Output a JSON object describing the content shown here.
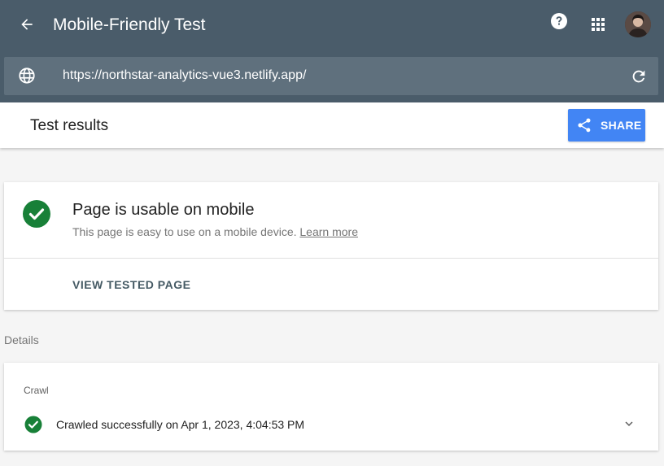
{
  "header": {
    "title": "Mobile-Friendly Test",
    "icons": {
      "back": "arrow-back-icon",
      "help": "help-icon",
      "apps": "apps-grid-icon",
      "avatar": "user-avatar"
    }
  },
  "url_bar": {
    "url": "https://northstar-analytics-vue3.netlify.app/",
    "icons": {
      "globe": "globe-icon",
      "reload": "reload-icon"
    }
  },
  "results": {
    "title": "Test results",
    "share_label": "SHARE"
  },
  "usable_card": {
    "title": "Page is usable on mobile",
    "description": "This page is easy to use on a mobile device.",
    "learn_more": "Learn more",
    "view_button": "VIEW TESTED PAGE"
  },
  "details": {
    "label": "Details",
    "crawl": {
      "label": "Crawl",
      "status": "Crawled successfully on Apr 1, 2023, 4:04:53 PM"
    }
  },
  "colors": {
    "header_bg": "#4a5c6a",
    "url_bar_bg": "#5f707d",
    "share_button": "#4285f4",
    "success_green": "#188038",
    "page_bg": "#f5f5f5"
  }
}
